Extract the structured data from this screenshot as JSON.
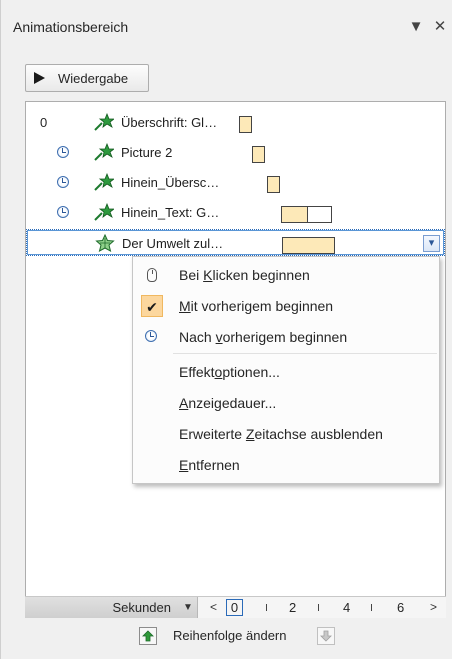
{
  "pane": {
    "title": "Animationsbereich"
  },
  "play": {
    "label": "Wiedergabe"
  },
  "colors": {
    "bar_fill": "#fde9b8",
    "accent": "#2a6ab8",
    "effect_green": "#1d7a2e",
    "check_bg": "#fcd79e"
  },
  "items": [
    {
      "number": "0",
      "trigger": "",
      "icon": "entrance-star-icon",
      "label": "Überschrift: Gl…"
    },
    {
      "number": "",
      "trigger": "clock-icon",
      "icon": "entrance-star-icon",
      "label": "Picture 2"
    },
    {
      "number": "",
      "trigger": "clock-icon",
      "icon": "entrance-star-icon",
      "label": "Hinein_Übersc…"
    },
    {
      "number": "",
      "trigger": "clock-icon",
      "icon": "entrance-star-icon",
      "label": "Hinein_Text: G…"
    },
    {
      "number": "",
      "trigger": "",
      "icon": "emphasis-star-icon",
      "label": "Der Umwelt zul…"
    }
  ],
  "menu": {
    "click_pre": "Bei ",
    "click_key": "K",
    "click_post": "licken beginnen",
    "with_key": "M",
    "with_post": "it vorherigem beginnen",
    "after_pre": "Nach ",
    "after_key": "v",
    "after_post": "orherigem beginnen",
    "effect_pre": "Effekt",
    "effect_key": "o",
    "effect_post": "ptionen...",
    "timing_key": "A",
    "timing_post": "nzeigedauer...",
    "timeline_pre": "Erweiterte ",
    "timeline_key": "Z",
    "timeline_post": "eitachse ausblenden",
    "remove_key": "E",
    "remove_post": "ntfernen"
  },
  "timeline": {
    "unit": "Sekunden",
    "ticks": [
      "0",
      "2",
      "4",
      "6"
    ]
  },
  "footer": {
    "reorder": "Reihenfolge ändern"
  }
}
